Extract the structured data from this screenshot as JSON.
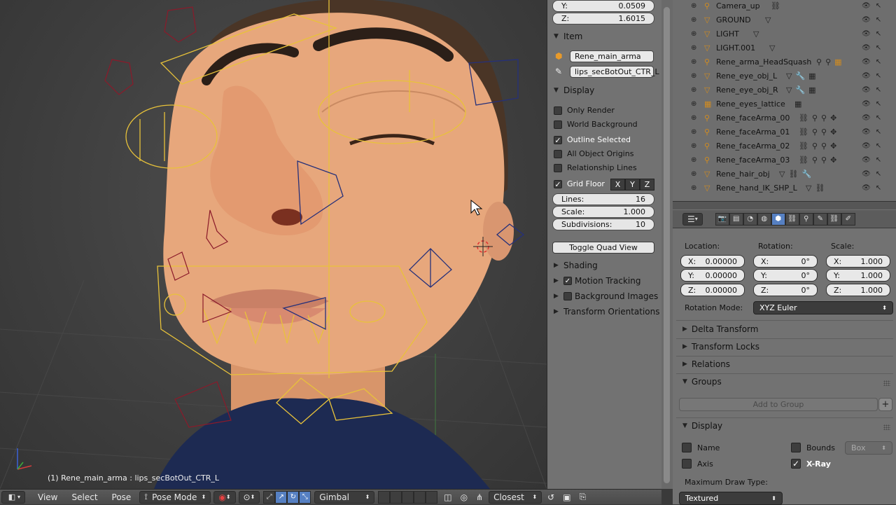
{
  "viewport": {
    "info_text": "(1) Rene_main_arma : lips_secBotOut_CTR_L"
  },
  "header": {
    "view": "View",
    "select": "Select",
    "pose": "Pose",
    "mode": "Pose Mode",
    "orientation": "Gimbal",
    "snap_target": "Closest"
  },
  "npanel": {
    "y_label": "Y:",
    "y_value": "0.0509",
    "z_label": "Z:",
    "z_value": "1.6015",
    "item_title": "Item",
    "item_object": "Rene_main_arma",
    "item_bone": "lips_secBotOut_CTR_L",
    "display_title": "Display",
    "options": [
      {
        "label": "Only Render",
        "checked": false
      },
      {
        "label": "World Background",
        "checked": false
      },
      {
        "label": "Outline Selected",
        "checked": true
      },
      {
        "label": "All Object Origins",
        "checked": false
      },
      {
        "label": "Relationship Lines",
        "checked": false
      }
    ],
    "grid_floor": "Grid Floor",
    "axes": [
      "X",
      "Y",
      "Z"
    ],
    "lines_label": "Lines:",
    "lines_value": "16",
    "scale_label": "Scale:",
    "scale_value": "1.000",
    "subdiv_label": "Subdivisions:",
    "subdiv_value": "10",
    "toggle_quad": "Toggle Quad View",
    "shading": "Shading",
    "motion_tracking": "Motion Tracking",
    "background_images": "Background Images",
    "transform_orientations": "Transform Orientations"
  },
  "outliner": {
    "rows": [
      {
        "name": "Camera_up",
        "icon": "armature-icon"
      },
      {
        "name": "GROUND",
        "icon": "mesh-icon"
      },
      {
        "name": "LIGHT",
        "icon": "mesh-icon"
      },
      {
        "name": "LIGHT.001",
        "icon": "mesh-icon"
      },
      {
        "name": "Rene_arma_HeadSquash",
        "icon": "armature-icon"
      },
      {
        "name": "Rene_eye_obj_L",
        "icon": "mesh-icon"
      },
      {
        "name": "Rene_eye_obj_R",
        "icon": "mesh-icon"
      },
      {
        "name": "Rene_eyes_lattice",
        "icon": "lattice-icon"
      },
      {
        "name": "Rene_faceArma_00",
        "icon": "armature-icon"
      },
      {
        "name": "Rene_faceArma_01",
        "icon": "armature-icon"
      },
      {
        "name": "Rene_faceArma_02",
        "icon": "armature-icon"
      },
      {
        "name": "Rene_faceArma_03",
        "icon": "armature-icon"
      },
      {
        "name": "Rene_hair_obj",
        "icon": "mesh-icon"
      },
      {
        "name": "Rene_hand_IK_SHP_L",
        "icon": "mesh-icon"
      }
    ]
  },
  "props": {
    "location_label": "Location:",
    "rotation_label": "Rotation:",
    "scale_label": "Scale:",
    "loc": [
      {
        "axis": "X:",
        "value": "0.00000"
      },
      {
        "axis": "Y:",
        "value": "0.00000"
      },
      {
        "axis": "Z:",
        "value": "0.00000"
      }
    ],
    "rot": [
      {
        "axis": "X:",
        "value": "0°"
      },
      {
        "axis": "Y:",
        "value": "0°"
      },
      {
        "axis": "Z:",
        "value": "0°"
      }
    ],
    "scl": [
      {
        "axis": "X:",
        "value": "1.000"
      },
      {
        "axis": "Y:",
        "value": "1.000"
      },
      {
        "axis": "Z:",
        "value": "1.000"
      }
    ],
    "rotation_mode_label": "Rotation Mode:",
    "rotation_mode": "XYZ Euler",
    "delta_transform": "Delta Transform",
    "transform_locks": "Transform Locks",
    "relations": "Relations",
    "groups": "Groups",
    "add_to_group": "Add to Group",
    "display": "Display",
    "name": "Name",
    "bounds": "Bounds",
    "bounds_type": "Box",
    "axis": "Axis",
    "xray": "X-Ray",
    "max_draw_type_label": "Maximum Draw Type:",
    "max_draw_type": "Textured"
  },
  "colors": {
    "accent": "#5680c2",
    "bone_selected": "#e8c23a",
    "bone_unselected": "#8b1a2a",
    "skin": "#e7a77c"
  }
}
